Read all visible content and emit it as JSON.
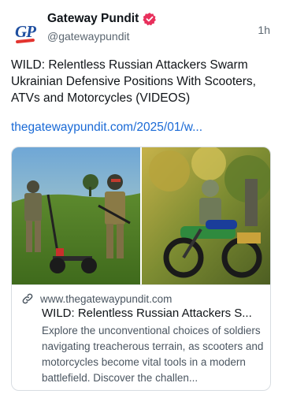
{
  "author": {
    "avatar_text": "GP",
    "display_name": "Gateway Pundit",
    "handle": "@gatewaypundit",
    "verified_icon": "verified-badge-icon",
    "timestamp": "1h"
  },
  "post": {
    "text": "WILD: Relentless Russian Attackers Swarm Ukrainian Defensive Positions With Scooters, ATVs and Motorcycles (VIDEOS)",
    "link_text": "thegatewaypundit.com/2025/01/w..."
  },
  "link_card": {
    "image": "soldiers-with-scooter-and-motorcycle-photo",
    "link_icon": "link-icon",
    "domain": "www.thegatewaypundit.com",
    "title": "WILD: Relentless Russian Attackers S...",
    "description": "Explore the unconventional choices of soldiers navigating treacherous terrain, as scooters and motorcycles become vital tools in a modern battlefield. Discover the challen..."
  },
  "colors": {
    "accent_link": "#1a6ad6",
    "verified_badge": "#e8305c",
    "secondary_text": "#5b6670"
  }
}
